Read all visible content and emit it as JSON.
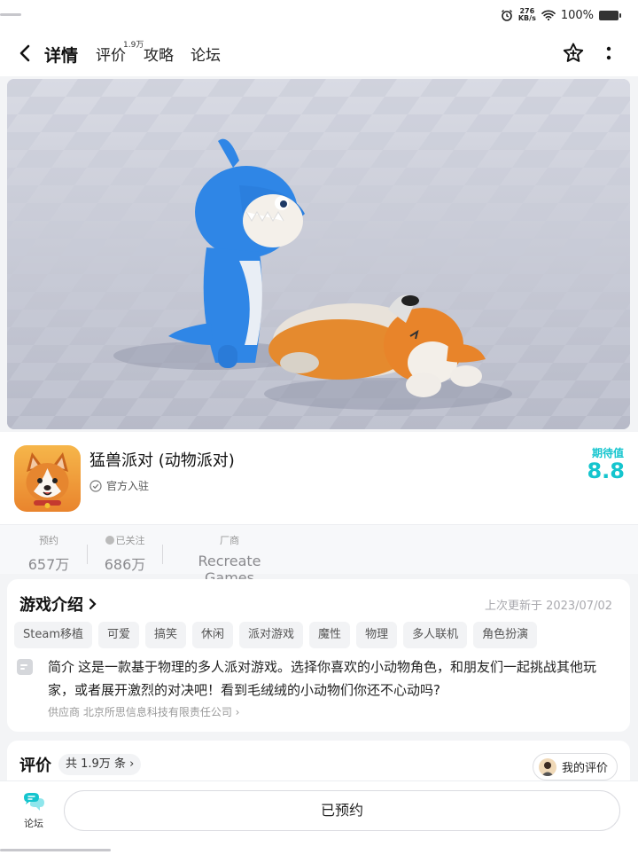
{
  "status": {
    "speed_top": "276",
    "speed_unit": "KB/s",
    "battery": "100%"
  },
  "topbar": {
    "tabs": [
      {
        "label": "详情",
        "active": true
      },
      {
        "label": "评价",
        "sup": "1.9万"
      },
      {
        "label": "攻略"
      },
      {
        "label": "论坛"
      }
    ]
  },
  "app": {
    "title": "猛兽派对 (动物派对)",
    "official": "官方入驻",
    "expect_label": "期待值",
    "expect_value": "8.8"
  },
  "stats": [
    {
      "label": "预约",
      "value": "657万"
    },
    {
      "label": "已关注",
      "value": "686万"
    },
    {
      "label": "厂商",
      "value": "Recreate Games"
    }
  ],
  "intro": {
    "title": "游戏介绍",
    "updated": "上次更新于 2023/07/02",
    "tags": [
      "Steam移植",
      "可爱",
      "搞笑",
      "休闲",
      "派对游戏",
      "魔性",
      "物理",
      "多人联机",
      "角色扮演"
    ],
    "desc_label": "简介",
    "desc": "这是一款基于物理的多人派对游戏。选择你喜欢的小动物角色，和朋友们一起挑战其他玩家，或者展开激烈的对决吧！看到毛绒绒的小动物们你还不心动吗?",
    "supplier": "供应商 北京所思信息科技有限责任公司"
  },
  "review": {
    "title": "评价",
    "count": "共 1.9万 条",
    "my_review": "我的评价"
  },
  "bottom": {
    "forum": "论坛",
    "reserve": "已预约"
  },
  "colors": {
    "accent": "#15c5ce"
  }
}
